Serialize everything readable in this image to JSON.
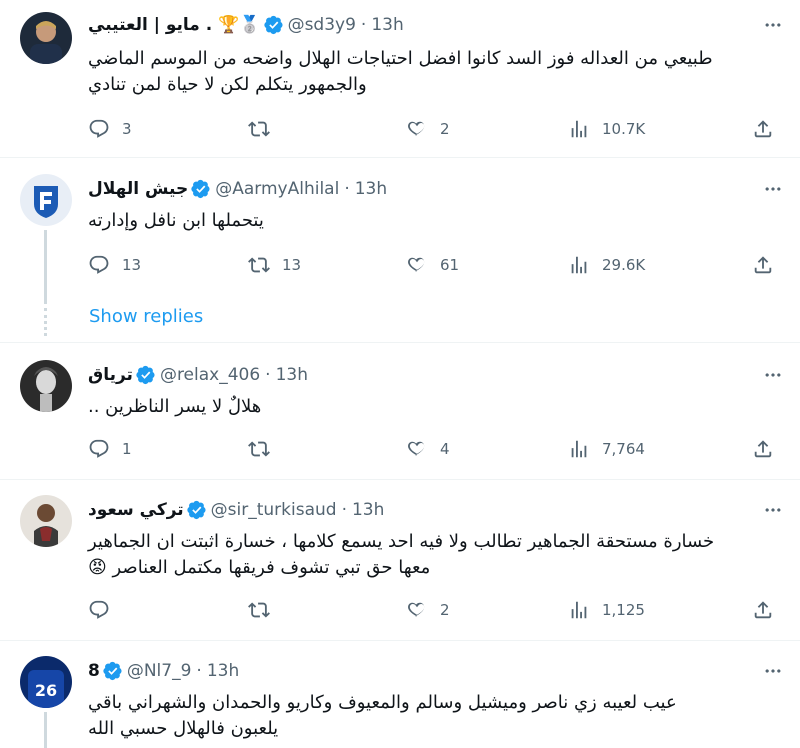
{
  "colors": {
    "accent": "#1d9bf0",
    "text": "#0f1419",
    "muted": "#536471",
    "verified": "#1d9bf0"
  },
  "tweets": [
    {
      "name": "مايو | العتيبي .",
      "badges": [
        "🏆",
        "🥈"
      ],
      "handle": "@sd3y9",
      "time": "13h",
      "lines": [
        "طبيعي من العداله فوز السد كانوا افضل احتياجات الهلال واضحه من الموسم الماضي",
        "والجمهور يتكلم لكن لا حياة لمن تنادي"
      ],
      "replies": "3",
      "retweets": "",
      "likes": "2",
      "views": "10.7K"
    },
    {
      "name": "جيش الهلال",
      "handle": "@AarmyAlhilal",
      "time": "13h",
      "lines": [
        "يتحملها ابن نافل وإدارته"
      ],
      "replies": "13",
      "retweets": "13",
      "likes": "61",
      "views": "29.6K",
      "show_replies": "Show replies"
    },
    {
      "name": "ترياق",
      "handle": "@relax_406",
      "time": "13h",
      "lines": [
        "هلالٌ لا يسر الناظرين .."
      ],
      "replies": "1",
      "retweets": "",
      "likes": "4",
      "views": "7,764"
    },
    {
      "name": "تركي سعود",
      "handle": "@sir_turkisaud",
      "time": "13h",
      "lines": [
        "خسارة مستحقة الجماهير تطالب ولا فيه احد يسمع كلامها ، خسارة اثبتت ان الجماهير",
        "معها حق تبي تشوف فريقها مكتمل العناصر 😡"
      ],
      "replies": "",
      "retweets": "",
      "likes": "2",
      "views": "1,125"
    },
    {
      "name": "8",
      "handle": "@Nl7_9",
      "time": "13h",
      "lines": [
        "عيب لعيبه زي ناصر وميشيل وسالم والمعيوف وكاريو والحمدان والشهراني باقي",
        "يلعبون فالهلال حسبي الله"
      ]
    }
  ]
}
